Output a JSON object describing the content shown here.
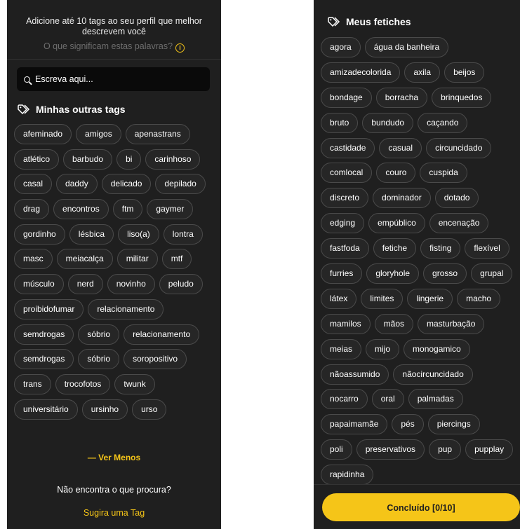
{
  "left_panel": {
    "intro_line1": "Adicione até 10 tags ao seu perfil que melhor",
    "intro_line2": "descrevem você",
    "meaning_link": "O que significam estas palavras?",
    "search_placeholder": "Escreva aqui...",
    "section_title": "Minhas outras tags",
    "tags": [
      "afeminado",
      "amigos",
      "apenastrans",
      "atlético",
      "barbudo",
      "bi",
      "carinhoso",
      "casal",
      "daddy",
      "delicado",
      "depilado",
      "drag",
      "encontros",
      "ftm",
      "gaymer",
      "gordinho",
      "lésbica",
      "liso(a)",
      "lontra",
      "masc",
      "meiacalça",
      "militar",
      "mtf",
      "músculo",
      "nerd",
      "novinho",
      "peludo",
      "proibidofumar",
      "relacionamento",
      "semdrogas",
      "sóbrio",
      "relacionamento",
      "semdrogas",
      "sóbrio",
      "soropositivo",
      "trans",
      "trocofotos",
      "twunk",
      "universitário",
      "ursinho",
      "urso"
    ],
    "ver_menos": "— Ver Menos",
    "not_found": "Não encontra o que procura?",
    "suggest": "Sugira uma Tag"
  },
  "right_panel": {
    "section_title": "Meus fetiches",
    "tags": [
      "agora",
      "água da banheira",
      "amizadecolorida",
      "axila",
      "beijos",
      "bondage",
      "borracha",
      "brinquedos",
      "bruto",
      "bundudo",
      "caçando",
      "castidade",
      "casual",
      "circuncidado",
      "comlocal",
      "couro",
      "cuspida",
      "discreto",
      "dominador",
      "dotado",
      "edging",
      "empúblico",
      "encenação",
      "fastfoda",
      "fetiche",
      "fisting",
      "flexível",
      "furries",
      "gloryhole",
      "grosso",
      "grupal",
      "látex",
      "limites",
      "lingerie",
      "macho",
      "mamilos",
      "mãos",
      "masturbação",
      "meias",
      "mijo",
      "monogamico",
      "nãoassumido",
      "nãocircuncidado",
      "nocarro",
      "oral",
      "palmadas",
      "papaimamãe",
      "pés",
      "piercings",
      "poli",
      "preservativos",
      "pup",
      "pupplay",
      "rapidinha"
    ],
    "done_button": "Concluído [0/10]"
  },
  "colors": {
    "accent": "#f5c518",
    "panel_bg": "#1f1f1f",
    "tag_border": "#4a4a4a"
  }
}
